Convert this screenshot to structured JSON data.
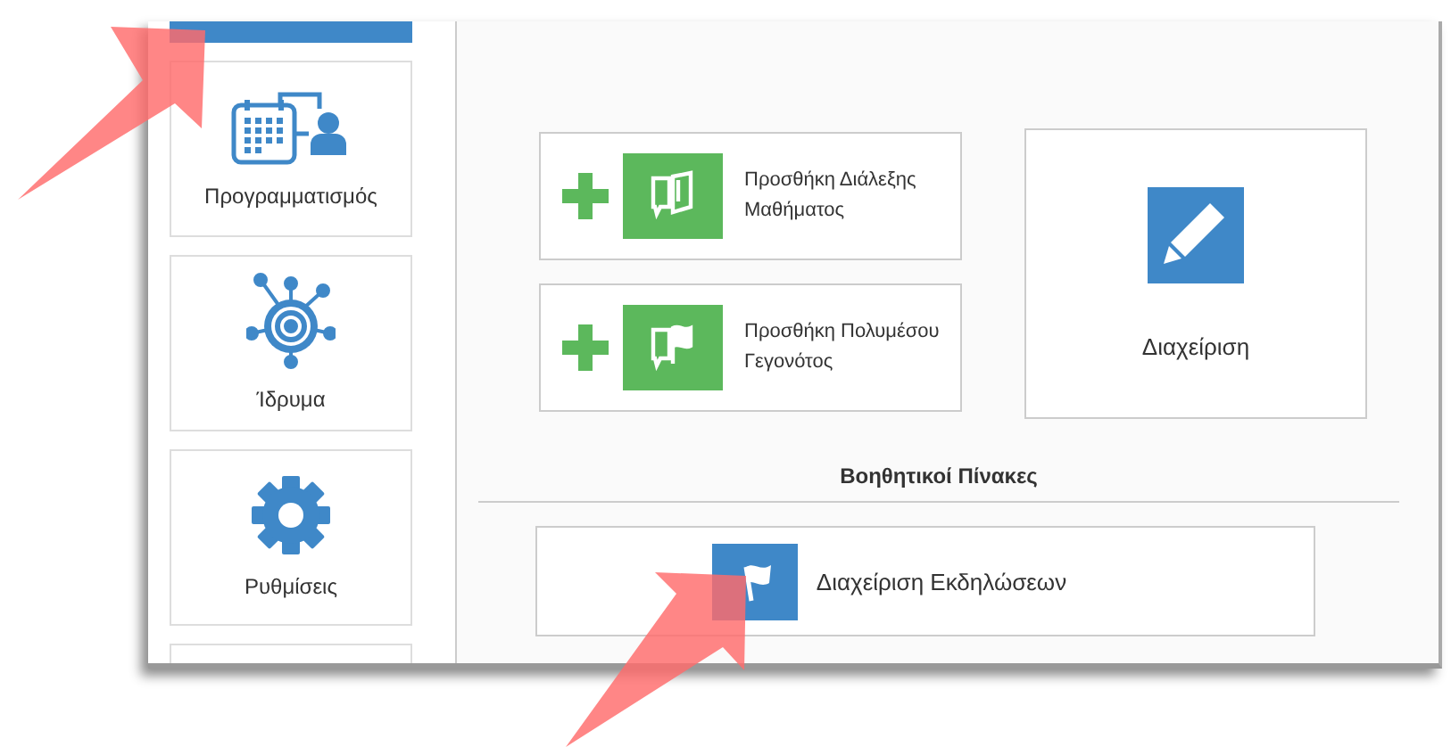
{
  "sidebar": {
    "items": [
      {
        "selected": true
      },
      {
        "label": "Προγραμματισμός",
        "selected": false
      },
      {
        "label": "Ίδρυμα",
        "selected": false
      },
      {
        "label": "Ρυθμίσεις",
        "selected": false
      },
      {
        "selected": false
      }
    ]
  },
  "actions": [
    {
      "label": "Προσθήκη Διάλεξης Μαθήματος"
    },
    {
      "label": "Προσθήκη Πολυμέσου Γεγονότος"
    }
  ],
  "manage": {
    "label": "Διαχείριση"
  },
  "section": {
    "title": "Βοηθητικοί Πίνακες",
    "items": [
      {
        "label": "Διαχείριση Εκδηλώσεων"
      }
    ]
  }
}
